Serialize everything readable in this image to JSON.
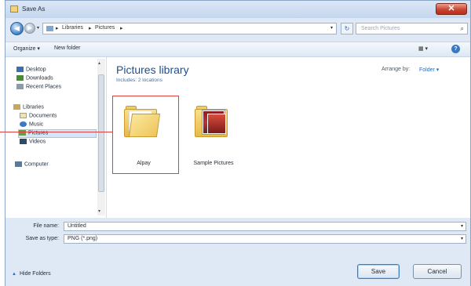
{
  "window": {
    "title": "Save As",
    "close_label": "✕"
  },
  "navbar": {
    "path": [
      "Libraries",
      "Pictures"
    ],
    "search_placeholder": "Search Pictures"
  },
  "toolbar": {
    "organize": "Organize ▾",
    "new_folder": "New folder",
    "help": "?"
  },
  "nav_pane": {
    "items": [
      {
        "label": "Desktop",
        "icon": "desktop-icon"
      },
      {
        "label": "Downloads",
        "icon": "downloads-icon"
      },
      {
        "label": "Recent Places",
        "icon": "recent-places-icon"
      },
      {
        "label": "Libraries",
        "icon": "libraries-icon"
      },
      {
        "label": "Documents",
        "icon": "documents-icon"
      },
      {
        "label": "Music",
        "icon": "music-icon"
      },
      {
        "label": "Pictures",
        "icon": "pictures-icon",
        "selected": true
      },
      {
        "label": "Videos",
        "icon": "videos-icon"
      },
      {
        "label": "Computer",
        "icon": "computer-icon"
      }
    ]
  },
  "content": {
    "library_title": "Pictures library",
    "library_subtitle": "Includes: 2 locations",
    "arrange_label": "Arrange by:",
    "arrange_value": "Folder ▾",
    "items": [
      {
        "label": "Alpay",
        "type": "folder"
      },
      {
        "label": "Sample Pictures",
        "type": "photo-folder"
      }
    ]
  },
  "form": {
    "file_name_label": "File name:",
    "file_name_value": "Untitled",
    "save_type_label": "Save as type:",
    "save_type_value": "PNG (*.png)"
  },
  "footer": {
    "hide_folders": "Hide Folders",
    "save_button": "Save",
    "cancel_button": "Cancel"
  },
  "colors": {
    "highlight": "#d94040",
    "accent": "#2d6bb5"
  }
}
